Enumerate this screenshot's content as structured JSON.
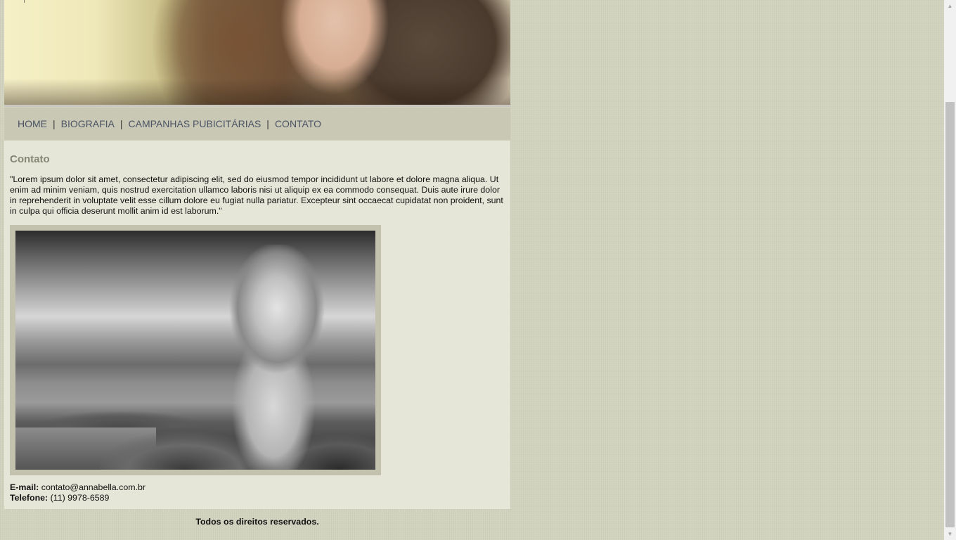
{
  "nav": {
    "items": [
      {
        "label": "HOME"
      },
      {
        "label": "BIOGRAFIA"
      },
      {
        "label": "CAMPANHAS PUBICITÁRIAS"
      },
      {
        "label": "CONTATO"
      }
    ],
    "separator": "|"
  },
  "content": {
    "title": "Contato",
    "paragraph": "\"Lorem ipsum dolor sit amet, consectetur adipiscing elit, sed do eiusmod tempor incididunt ut labore et dolore magna aliqua. Ut enim ad minim veniam, quis nostrud exercitation ullamco laboris nisi ut aliquip ex ea commodo consequat. Duis aute irure dolor in reprehenderit in voluptate velit esse cillum dolore eu fugiat nulla pariatur. Excepteur sint occaecat cupidatat non proident, sunt in culpa qui officia deserunt mollit anim id est laborum.\"",
    "email_label": "E-mail:",
    "email_value": "contato@annabella.com.br",
    "phone_label": "Telefone:",
    "phone_value": "(11) 9978-6589"
  },
  "footer": {
    "text": "Todos os direitos reservados."
  },
  "scrollbar": {
    "up_icon": "▲",
    "down_icon": "▼"
  },
  "colors": {
    "page_background": "#d2d3bf",
    "nav_background": "#c8c8b4",
    "content_background": "#e6e6d8",
    "nav_link": "#4c5466",
    "title": "#868676"
  }
}
